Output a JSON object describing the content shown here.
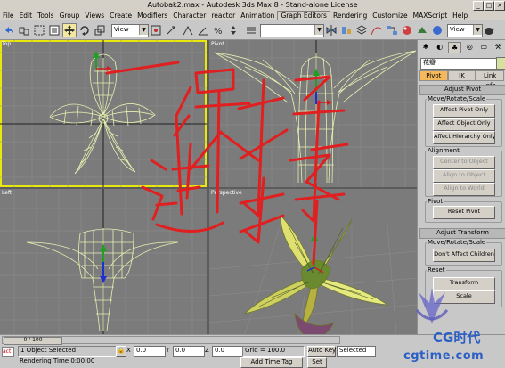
{
  "window": {
    "title": "Autobak2.max - Autodesk 3ds Max 8  - Stand-alone License"
  },
  "menu": [
    "File",
    "Edit",
    "Tools",
    "Group",
    "Views",
    "Create",
    "Modifiers",
    "Character",
    "reactor",
    "Animation",
    "Graph Editors",
    "Rendering",
    "Customize",
    "MAXScript",
    "Help"
  ],
  "toolbar": {
    "view_combo": "View",
    "view_combo2": "View",
    "named_sel": ""
  },
  "viewports": {
    "top_label": "Top",
    "front_label": "Pivot",
    "left_label": "Left",
    "persp_label": "Perspective"
  },
  "command_panel": {
    "object_name": "花瓣",
    "subtabs": [
      "Pivot",
      "IK",
      "Link Info"
    ],
    "adjust_pivot_title": "Adjust Pivot",
    "move_rotate_scale_label": "Move/Rotate/Scale",
    "btn_affect_pivot": "Affect Pivot Only",
    "btn_affect_object": "Affect Object Only",
    "btn_affect_hierarchy": "Affect Hierarchy Only",
    "alignment_label": "Alignment",
    "btn_center_to_object": "Center to Object",
    "btn_align_to_object": "Align to Object",
    "btn_align_to_world": "Align to World",
    "pivot_label": "Pivot",
    "btn_reset_pivot": "Reset Pivot",
    "adjust_transform_title": "Adjust Transform",
    "move_rotate_scale_label2": "Move/Rotate/Scale",
    "btn_dont_affect_children": "Don't Affect Children",
    "reset_label": "Reset",
    "btn_transform": "Transform",
    "btn_scale": "Scale"
  },
  "status": {
    "frame_slider": "0 / 100",
    "selection_text": "1 Object Selected",
    "render_time": "Rendering Time  0:00:00",
    "x_label": "X",
    "x_value": "0.0",
    "y_label": "Y",
    "y_value": "0.0",
    "z_label": "Z",
    "z_value": "0.0",
    "grid": "Grid = 100.0",
    "add_time_tag": "Add Time Tag",
    "auto_key": "Auto Key",
    "selected": "Selected",
    "set_key": "Set",
    "act_label": "act"
  },
  "annotation": {
    "handwriting": "一保持选择"
  },
  "watermark": {
    "brand": "CG时代",
    "url": "cgtime.com"
  },
  "colors": {
    "viewport_bg": "#7b7b7b",
    "active_border": "#e8e80c",
    "wire": "#d8e8a0",
    "red_ink": "#e02020"
  }
}
